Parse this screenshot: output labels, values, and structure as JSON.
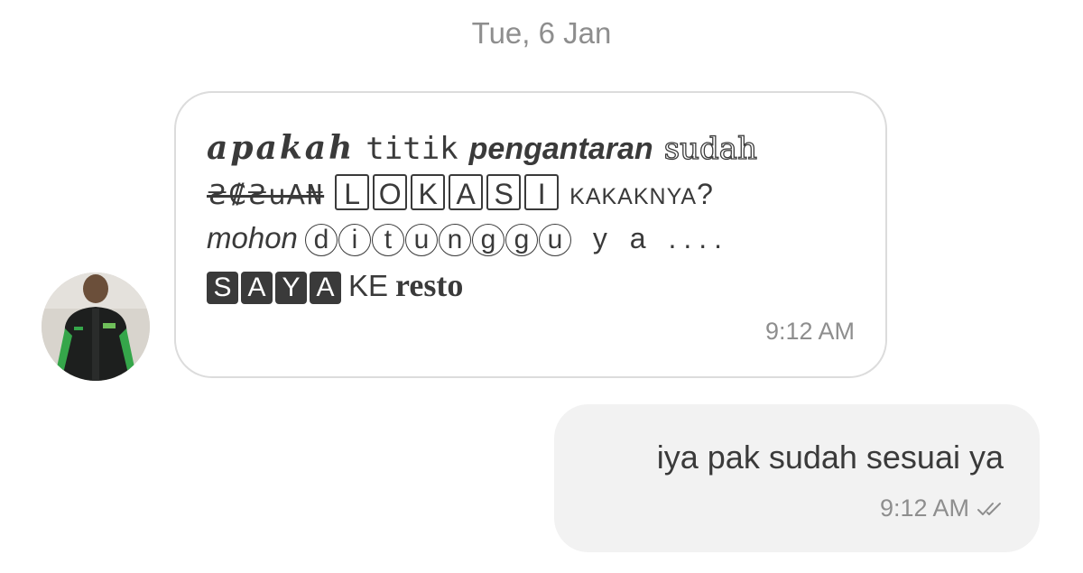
{
  "chat": {
    "date_separator": "Tue, 6 Jan",
    "incoming": {
      "avatar_icon": "person-avatar",
      "line1": [
        "apakah",
        "titik",
        "pengantaran",
        "sudah"
      ],
      "line2_strike": "₴₡₴uA₦",
      "line2_boxed": [
        "L",
        "O",
        "K",
        "A",
        "S",
        "I"
      ],
      "line2_tail": "KAKAKNYA",
      "line2_q": "?",
      "line3_italic": "mohon",
      "line3_circled": [
        "d",
        "i",
        "t",
        "u",
        "n",
        "g",
        "g",
        "u"
      ],
      "line3_tail": "y a ....",
      "line4_filled": [
        "S",
        "A",
        "Y",
        "A"
      ],
      "line4_plain": "KE",
      "line4_bold": "resto",
      "time": "9:12 AM"
    },
    "outgoing": {
      "text": "iya pak sudah sesuai ya",
      "time": "9:12 AM",
      "status_icon": "double-check-icon"
    }
  },
  "colors": {
    "text": "#3a3a3a",
    "meta": "#8e8e8e",
    "outgoing_bg": "#f2f2f2",
    "incoming_border": "#dcdcdc"
  }
}
